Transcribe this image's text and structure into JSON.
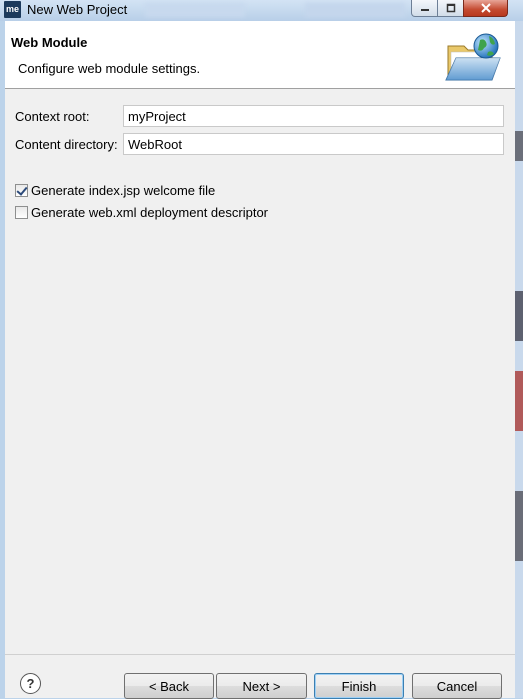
{
  "window": {
    "app_icon_text": "me",
    "title": "New Web Project"
  },
  "header": {
    "title": "Web Module",
    "description": "Configure web module settings.",
    "icon": "folder-globe-icon"
  },
  "form": {
    "context_root": {
      "label": "Context root:",
      "value": "myProject"
    },
    "content_directory": {
      "label": "Content directory:",
      "value": "WebRoot"
    }
  },
  "options": {
    "generate_index": {
      "label": "Generate index.jsp welcome file",
      "checked": true
    },
    "generate_webxml": {
      "label": "Generate web.xml deployment descriptor",
      "checked": false
    }
  },
  "buttons": {
    "help": "?",
    "back": "< Back",
    "next": "Next >",
    "finish": "Finish",
    "cancel": "Cancel"
  },
  "colors": {
    "title_bar": "#c6d9ef",
    "dialog_bg": "#f0f0f0",
    "close_button": "#c44a30",
    "default_button_border": "#3c7fb1"
  }
}
